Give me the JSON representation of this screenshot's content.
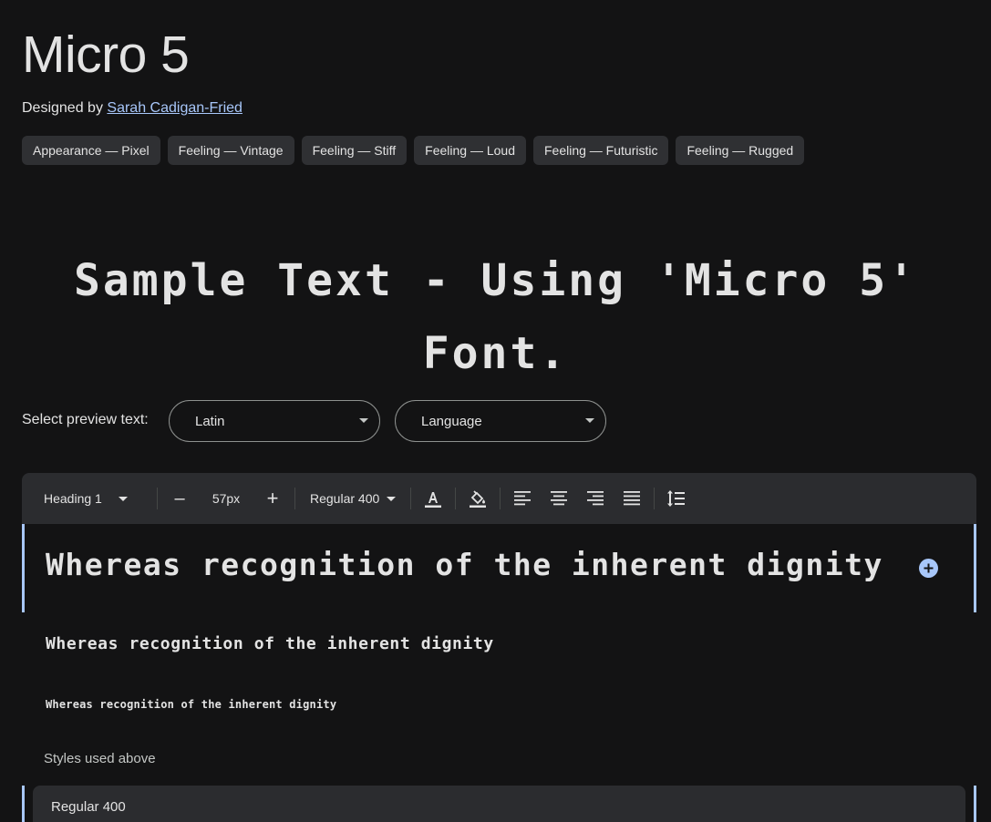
{
  "font": {
    "name": "Micro 5",
    "designed_by_label": "Designed by",
    "designer": "Sarah Cadigan-Fried"
  },
  "tags": [
    "Appearance — Pixel",
    "Feeling — Vintage",
    "Feeling — Stiff",
    "Feeling — Loud",
    "Feeling — Futuristic",
    "Feeling — Rugged"
  ],
  "hero_text": "Sample Text - Using 'Micro 5' Font.",
  "preview": {
    "label": "Select preview text:",
    "script_value": "Latin",
    "language_value": "Language"
  },
  "toolbar": {
    "style": "Heading 1",
    "size": "57px",
    "weight": "Regular 400",
    "decrease_symbol": "–",
    "increase_symbol": "+"
  },
  "samples": [
    "Whereas recognition of the inherent dignity",
    "Whereas recognition of the inherent dignity",
    "Whereas recognition of the inherent dignity"
  ],
  "styles": {
    "label": "Styles used above",
    "first_style": "Regular 400"
  },
  "icons": {
    "text_color": "format-color-text-icon",
    "fill_color": "format-color-fill-icon",
    "align_left": "align-left-icon",
    "align_center": "align-center-icon",
    "align_right": "align-right-icon",
    "align_justify": "align-justify-icon",
    "line_height": "line-height-icon",
    "add": "add-circle-icon"
  },
  "colors": {
    "background": "#131314",
    "accent": "#a8c7fa",
    "chip": "#2f3033",
    "toolbar": "#2b2c2f"
  }
}
